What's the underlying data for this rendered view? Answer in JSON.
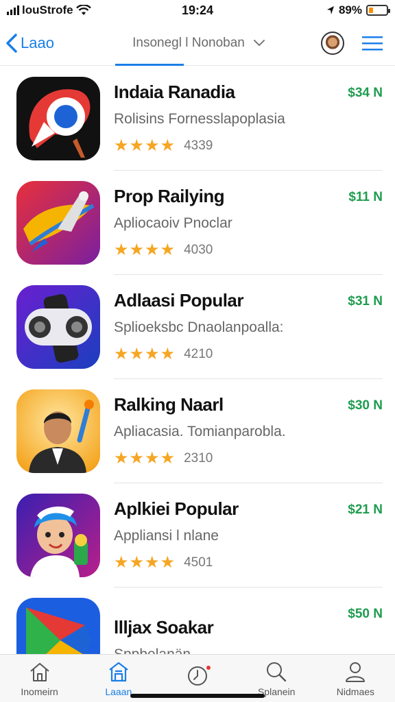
{
  "status_bar": {
    "carrier": "louStrofe",
    "time": "19:24",
    "battery": "89%",
    "battery_level": 0.25
  },
  "nav": {
    "back_label": "Laao",
    "title": "Insonegl l Nonoban",
    "accent_color": "#1a7ee8"
  },
  "apps": [
    {
      "name": "Indaia Ranadia",
      "subtitle": "Rolisins Fornesslapoplasia",
      "stars": "★★★★",
      "count": "4339",
      "price": "$34 N",
      "icon": "chrome-bird-icon"
    },
    {
      "name": "Prop Railying",
      "subtitle": "Apliocaoiv Pnoclar",
      "stars": "★★★★",
      "count": "4030",
      "price": "$11 N",
      "icon": "rocket-icon"
    },
    {
      "name": "Adlaasi Popular",
      "subtitle": "Splioeksbc Dnaolanpoalla:",
      "stars": "★★★★",
      "count": "4210",
      "price": "$31 N",
      "icon": "gamepad-icon"
    },
    {
      "name": "Ralking Naarl",
      "subtitle": "Apliacasia. Tomianparobla.",
      "stars": "★★★★",
      "count": "2310",
      "price": "$30 N",
      "icon": "portrait-icon"
    },
    {
      "name": "Aplkiei Popular",
      "subtitle": "Appliansi l nlane",
      "stars": "★★★★",
      "count": "4501",
      "price": "$21 N",
      "icon": "cartoon-icon"
    },
    {
      "name": "llljax Soakar",
      "subtitle": "Sppbelanän",
      "stars": "",
      "count": "",
      "price": "$50 N",
      "icon": "play-icon"
    }
  ],
  "tabs": [
    {
      "label": "Inomeirn",
      "icon": "home-icon"
    },
    {
      "label": "Laaan",
      "icon": "store-icon"
    },
    {
      "label": "",
      "icon": "clock-icon"
    },
    {
      "label": "Splanein",
      "icon": "search-icon"
    },
    {
      "label": "Nidmaes",
      "icon": "profile-icon"
    }
  ],
  "colors": {
    "price": "#1e9c4e",
    "star": "#f5a623",
    "battery": "#ff8a00"
  }
}
